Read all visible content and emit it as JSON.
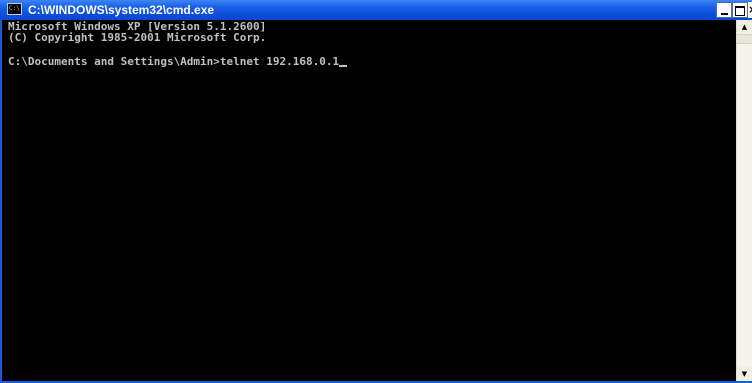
{
  "window": {
    "title": "C:\\WINDOWS\\system32\\cmd.exe",
    "icon_text": "C:\\",
    "controls": {
      "minimize": "minimize-icon",
      "maximize": "maximize-icon",
      "close": "close-icon",
      "close_glyph": "×"
    }
  },
  "console": {
    "lines": [
      "Microsoft Windows XP [Version 5.1.2600]",
      "(C) Copyright 1985-2001 Microsoft Corp.",
      "C:\\Documents and Settings\\Admin>telnet 192.168.0.1"
    ],
    "foreground": "#c0c0c0",
    "background": "#000000"
  },
  "scrollbar": {
    "up_glyph": "▲",
    "down_glyph": "▼"
  },
  "colors": {
    "titlebar": "#0c4fd8",
    "title_text": "#ffffff"
  }
}
